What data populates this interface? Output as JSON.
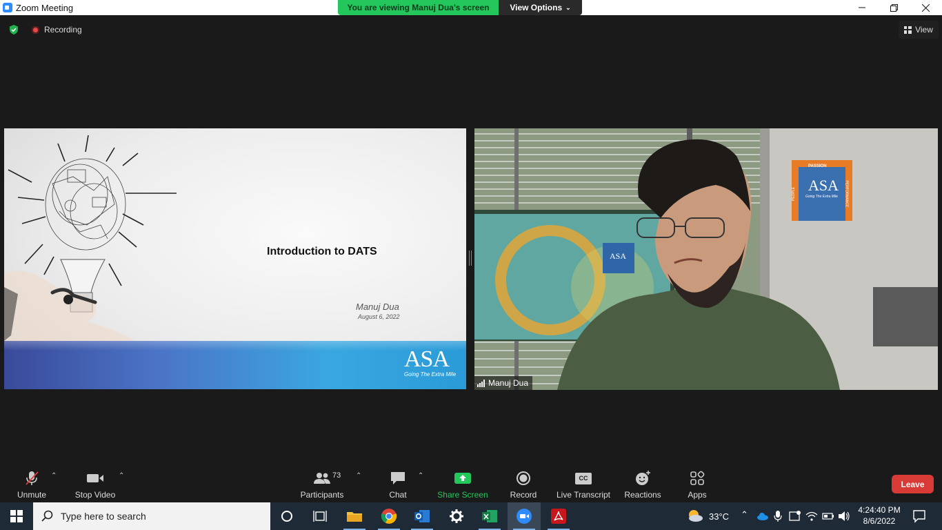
{
  "window": {
    "title": "Zoom Meeting",
    "banner_text": "You are viewing Manuj Dua's screen",
    "view_options_label": "View Options",
    "controls": [
      "minimize",
      "maximize",
      "close"
    ]
  },
  "meeting_bar": {
    "recording_label": "Recording",
    "view_label": "View"
  },
  "slide": {
    "title": "Introduction to DATS",
    "author": "Manuj Dua",
    "date": "August 6, 2022",
    "logo_text": "ASA",
    "logo_tagline": "Going The Extra Mile"
  },
  "video": {
    "participant_name": "Manuj Dua",
    "poster_top": "PASSION",
    "poster_left": "PEOPLE",
    "poster_right": "PERFORMANCE",
    "poster_logo": "ASA",
    "poster_tagline": "Going The Extra Mile"
  },
  "toolbar": {
    "unmute_label": "Unmute",
    "stop_video_label": "Stop Video",
    "participants_label": "Participants",
    "participants_count": "73",
    "chat_label": "Chat",
    "share_screen_label": "Share Screen",
    "record_label": "Record",
    "live_transcript_label": "Live Transcript",
    "cc_text": "CC",
    "reactions_label": "Reactions",
    "apps_label": "Apps",
    "leave_label": "Leave"
  },
  "taskbar": {
    "search_placeholder": "Type here to search",
    "temperature": "33°C",
    "time": "4:24:40 PM",
    "date": "8/6/2022"
  },
  "colors": {
    "banner_green": "#23c75c",
    "leave_red": "#d83a36",
    "share_green": "#23c75c",
    "toolbar_bg": "#1a1a1a"
  }
}
